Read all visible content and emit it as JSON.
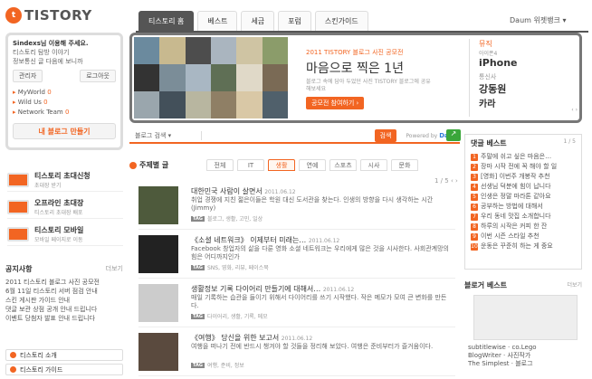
{
  "logo": {
    "mark": "t",
    "word": "TISTORY"
  },
  "gnb": {
    "tabs": [
      "티스토리 홈",
      "베스트",
      "세금",
      "포럼",
      "스킨가이드"
    ],
    "daum": "Daum 위젯뱅크 ▾"
  },
  "login": {
    "title": "Sindexs님 이용해 주세요.",
    "lines": [
      "티스토리 탐방 이야기",
      "정보통신 글 다음에 보니까"
    ],
    "btn1": "관리자",
    "btn2": "로그아웃",
    "items": [
      {
        "name": "MyWorld",
        "count": "0"
      },
      {
        "name": "Wild Us",
        "count": "0"
      },
      {
        "name": "Network Team",
        "count": "0"
      }
    ],
    "myblog": "내 블로그 만들기"
  },
  "services": [
    {
      "title": "티스토리 초대신청",
      "sub": "초대장 받기"
    },
    {
      "title": "오프라인 초대장",
      "sub": "티스토리 초대장 배포"
    },
    {
      "title": "티스토리 모바일",
      "sub": "모바일 페이지로 이동"
    }
  ],
  "notice": {
    "title": "공지사항",
    "more": "더보기",
    "rows": [
      "2011 티스토리 블로그 사진 공모전",
      "6월 11일 티스토리 서버 점검 안내",
      "스킨 게시판 가이드 안내",
      "댓글 보관 상점 공개 안내 드립니다",
      "이벤트 당첨자 발표 안내 드립니다"
    ]
  },
  "bottom_buttons": [
    "티스토리 소개",
    "티스토리 가이드"
  ],
  "banner": {
    "small": "2011 TISTORY 블로그 사진 공모전",
    "large": "마음으로 찍은 1년",
    "desc": "블로그 속에 담아 두었던 사진 TISTORY 블로그에 공유해보세요",
    "cta": "공모전 참여하기 ›",
    "side": {
      "s1": "뮤직",
      "s2": "아이폰4",
      "s3": "iPhone",
      "s4": "통신사",
      "s5": "강동원",
      "s6": "카라",
      "s7": "‹ ›"
    }
  },
  "search": {
    "select": "블로그 검색 ▾",
    "placeholder": "",
    "button": "검색",
    "powered": "Powered by",
    "daum": "Daum"
  },
  "topics": {
    "title": "주제별 글",
    "tabs": [
      "전체",
      "IT",
      "생활",
      "연예",
      "스포츠",
      "시사",
      "문화"
    ],
    "active": 2,
    "pager": "1 / 5 ‹ ›"
  },
  "posts": [
    {
      "title": "대한민국 사람이 살면서",
      "date": "2011.06.12",
      "desc": "취업 경쟁에 지친 젊은이들은 학원 대신 도서관을 찾는다. 인생의 방향을 다시 생각하는 시간 (Jimmy)",
      "tags": "블로그, 생활, 고민, 일상"
    },
    {
      "title": "《소셜 네트워크》 이제부터 미래는…",
      "date": "2011.06.12",
      "desc": "Facebook 창업자의 삶을 다룬 영화 소셜 네트워크는 우리에게 많은 것을 시사한다. 사회관계망의 힘은 어디까지인가",
      "tags": "SNS, 영화, 리뷰, 페이스북"
    },
    {
      "title": "생활정보 기록 다이어리 만들기에 대해서…",
      "date": "2011.06.12",
      "desc": "매일 기록하는 습관을 들이기 위해서 다이어리를 쓰기 시작했다. 작은 메모가 모여 큰 변화를 만든다.",
      "tags": "다이어리, 생활, 기록, 메모"
    },
    {
      "title": "《여행》 당신을 위한 보고서",
      "date": "2011.06.12",
      "desc": "여행을 떠나기 전에 반드시 챙겨야 할 것들을 정리해 보았다. 여행은 준비부터가 즐거움이다.",
      "tags": "여행, 준비, 정보"
    }
  ],
  "comments": {
    "title": "댓글 베스트",
    "more": "1 / 5",
    "rows": [
      "주말에 쉬고 싶은 마음은…",
      "장마 시작 전에 꼭 해야 할 일",
      "[영화] 이번주 개봉작 추천",
      "선생님 덕분에 힘이 납니다",
      "인생은 정말 마라톤 같아요",
      "공부하는 방법에 대해서",
      "우리 동네 맛집 소개합니다",
      "하루의 시작은 커피 한 잔",
      "이번 시즌 스타일 추천",
      "운동은 꾸준히 하는 게 중요"
    ]
  },
  "blogbest": {
    "title": "블로거 베스트",
    "more": "더보기",
    "rows": [
      "subtitlewise  ·  co.Lego",
      "BlogWriter  ·  사진작가",
      "The Simplest  ·  블로그"
    ]
  }
}
